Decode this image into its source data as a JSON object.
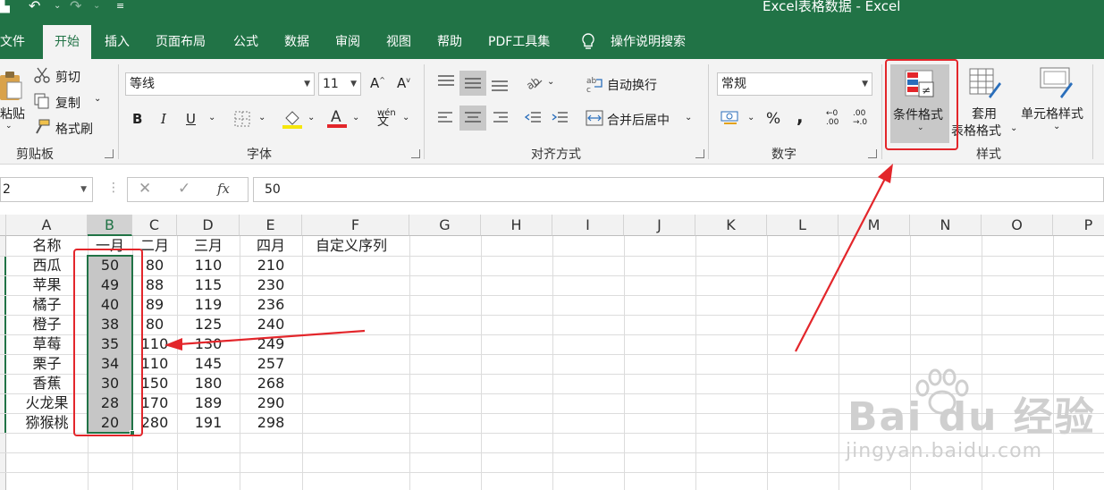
{
  "title_bar": {
    "title": "Excel表格数据  -  Excel",
    "undo_icon": "undo-icon",
    "redo_icon": "redo-icon",
    "save_icon": "save-icon"
  },
  "menu": {
    "items": [
      "文件",
      "开始",
      "插入",
      "页面布局",
      "公式",
      "数据",
      "审阅",
      "视图",
      "帮助",
      "PDF工具集"
    ],
    "active": "开始",
    "tell_me": "操作说明搜索"
  },
  "clipboard": {
    "paste": "粘贴",
    "cut": "剪切",
    "copy": "复制",
    "format_painter": "格式刷",
    "label": "剪贴板"
  },
  "font": {
    "name": "等线",
    "size": "11",
    "bold": "B",
    "italic": "I",
    "underline": "U",
    "label": "字体",
    "phonetic": "wén"
  },
  "alignment": {
    "wrap": "自动换行",
    "merge": "合并后居中",
    "label": "对齐方式"
  },
  "number": {
    "format": "常规",
    "percent": "%",
    "comma": ",",
    "label": "数字",
    "increase_decimal": ".00",
    "decrease_decimal": ".0"
  },
  "styles": {
    "conditional": "条件格式",
    "table_line1": "套用",
    "table_line2": "表格格式",
    "cell_styles": "单元格样式",
    "label": "样式"
  },
  "formula_bar": {
    "name_box": "2",
    "value": "50",
    "fx": "fx"
  },
  "columns": [
    "A",
    "B",
    "C",
    "D",
    "E",
    "F",
    "G",
    "H",
    "I",
    "J",
    "K",
    "L",
    "M",
    "N",
    "O",
    "P"
  ],
  "table": {
    "headers": [
      "名称",
      "一月",
      "二月",
      "三月",
      "四月",
      "自定义序列"
    ],
    "rows": [
      [
        "西瓜",
        "50",
        "80",
        "110",
        "210"
      ],
      [
        "苹果",
        "49",
        "88",
        "115",
        "230"
      ],
      [
        "橘子",
        "40",
        "89",
        "119",
        "236"
      ],
      [
        "橙子",
        "38",
        "80",
        "125",
        "240"
      ],
      [
        "草莓",
        "35",
        "110",
        "130",
        "249"
      ],
      [
        "栗子",
        "34",
        "110",
        "145",
        "257"
      ],
      [
        "香蕉",
        "30",
        "150",
        "180",
        "268"
      ],
      [
        "火龙果",
        "28",
        "170",
        "189",
        "290"
      ],
      [
        "猕猴桃",
        "20",
        "280",
        "191",
        "298"
      ]
    ]
  },
  "watermark": {
    "brand": "Bai du 经验",
    "url": "jingyan.baidu.com"
  },
  "colors": {
    "excel_green": "#217346",
    "annotation_red": "#e3262b"
  }
}
